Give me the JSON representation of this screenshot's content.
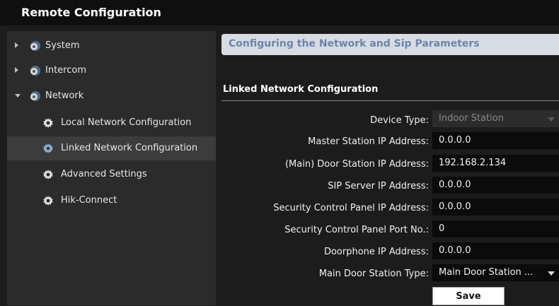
{
  "window": {
    "title": "Remote Configuration"
  },
  "sidebar": {
    "items": [
      {
        "label": "System",
        "level": 0,
        "expanded": false,
        "icon": "gear-group-icon"
      },
      {
        "label": "Intercom",
        "level": 0,
        "expanded": false,
        "icon": "gear-group-icon"
      },
      {
        "label": "Network",
        "level": 0,
        "expanded": true,
        "icon": "gear-group-icon"
      },
      {
        "label": "Local Network Configuration",
        "level": 1,
        "icon": "gear-icon"
      },
      {
        "label": "Linked Network Configuration",
        "level": 1,
        "selected": true,
        "icon": "gear-icon"
      },
      {
        "label": "Advanced Settings",
        "level": 1,
        "icon": "gear-icon"
      },
      {
        "label": "Hik-Connect",
        "level": 1,
        "icon": "gear-icon"
      }
    ]
  },
  "main": {
    "header": "Configuring the Network and Sip Parameters",
    "section_title": "Linked Network Configuration",
    "fields": [
      {
        "label": "Device Type:",
        "value": "Indoor Station",
        "kind": "select",
        "disabled": true
      },
      {
        "label": "Master Station IP Address:",
        "value": "0.0.0.0"
      },
      {
        "label": "(Main) Door Station IP Address:",
        "value": "192.168.2.134"
      },
      {
        "label": "SIP Server IP Address:",
        "value": "0.0.0.0"
      },
      {
        "label": "Security Control Panel IP Address:",
        "value": "0.0.0.0"
      },
      {
        "label": "Security Control Panel Port No.:",
        "value": "0"
      },
      {
        "label": "Doorphone IP Address:",
        "value": "0.0.0.0"
      },
      {
        "label": "Main Door Station Type:",
        "value": "Main Door Station ...",
        "kind": "select"
      }
    ],
    "save_label": "Save"
  },
  "colors": {
    "accent_header_text": "#6d85a8",
    "header_bg": "#d7dce3",
    "selected_item": "#3c3c3c"
  }
}
